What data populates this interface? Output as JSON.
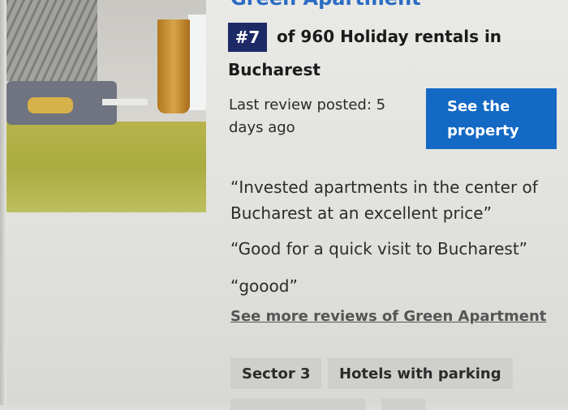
{
  "listing": {
    "title": "Green Apartment",
    "rank_badge": "#7",
    "rank_text": "of 960 Holiday rentals in",
    "rank_city": "Bucharest",
    "last_review": "Last review posted: 5 days ago",
    "cta_label": "See the property"
  },
  "reviews": [
    "“Invested apartments in the center of Bucharest at an excellent price”",
    "“Good for a quick visit to Bucharest”",
    "“goood”"
  ],
  "more_reviews_link": "See more reviews of Green Apartment",
  "tags": [
    "Sector 3",
    "Hotels with parking"
  ],
  "colors": {
    "rank_badge_bg": "#1d2a66",
    "cta_bg": "#1469c4",
    "title": "#2b6cc4"
  }
}
